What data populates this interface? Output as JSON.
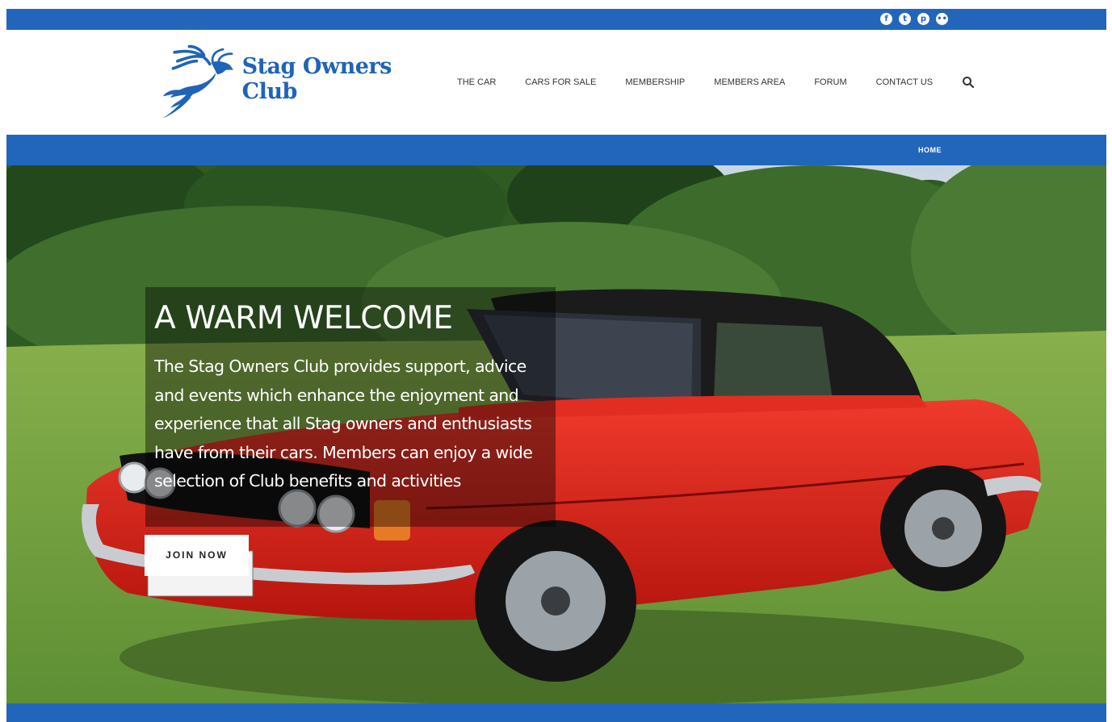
{
  "topbar": {
    "social": [
      {
        "icon": "facebook-icon",
        "glyph": "f"
      },
      {
        "icon": "twitter-icon",
        "glyph": "t"
      },
      {
        "icon": "pinterest-icon",
        "glyph": "p"
      },
      {
        "icon": "flickr-icon",
        "glyph": "••"
      }
    ]
  },
  "header": {
    "logo_text": "Stag Owners Club",
    "nav": [
      "THE CAR",
      "CARS FOR SALE",
      "MEMBERSHIP",
      "MEMBERS AREA",
      "FORUM",
      "CONTACT US"
    ]
  },
  "breadcrumb": {
    "current": "HOME"
  },
  "hero": {
    "title": "A WARM WELCOME",
    "text": "The Stag Owners Club provides support, advice and events which enhance the enjoyment and experience that all Stag owners and enthusiasts have from their cars. Members can enjoy a wide selection of Club benefits and activities",
    "button": "JOIN NOW"
  },
  "colors": {
    "brand": "#2266bb",
    "car": "#d81d14",
    "grass": "#6f9e3e"
  }
}
